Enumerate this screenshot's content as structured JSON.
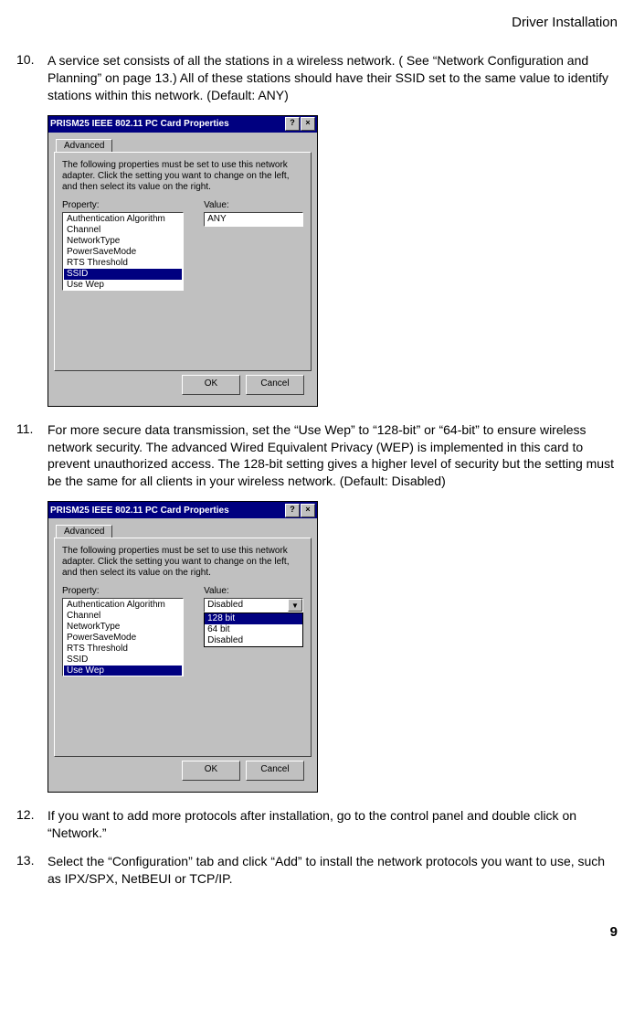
{
  "header": "Driver Installation",
  "page_number": "9",
  "steps": {
    "n10": "10.",
    "t10": "A service set consists of all the stations in a wireless network. ( See “Network Configuration and Planning” on page 13.) All of these stations should have their SSID set to the same value to identify stations within this network. (Default: ANY)",
    "n11": "11.",
    "t11": "For more secure data transmission, set the “Use Wep” to “128-bit” or “64-bit” to ensure wireless network security. The advanced Wired Equivalent Privacy (WEP) is implemented in this card to prevent unauthorized access. The 128-bit setting gives a higher level of security but the setting must be the same for all clients in your wireless network. (Default: Disabled)",
    "n12": "12.",
    "t12": "If you want to add more protocols after installation, go to the control panel and double click on “Network.”",
    "n13": "13.",
    "t13": "Select the “Configuration” tab and click “Add” to install the network protocols you want to use, such as IPX/SPX, NetBEUI or TCP/IP."
  },
  "dialog": {
    "title": "PRISM25 IEEE 802.11 PC Card Properties",
    "help_btn": "?",
    "close_btn": "×",
    "tab": "Advanced",
    "hint": "The following properties must be set to use this network adapter. Click the setting you want to change on the left, and then select its value on the right.",
    "property_label": "Property:",
    "value_label": "Value:",
    "ok": "OK",
    "cancel": "Cancel"
  },
  "shot1": {
    "properties": {
      "p0": "Authentication Algorithm",
      "p1": "Channel",
      "p2": "NetworkType",
      "p3": "PowerSaveMode",
      "p4": "RTS Threshold",
      "p5": "SSID",
      "p6": "Use Wep"
    },
    "selected_property": "SSID",
    "value": "ANY"
  },
  "shot2": {
    "properties": {
      "p0": "Authentication Algorithm",
      "p1": "Channel",
      "p2": "NetworkType",
      "p3": "PowerSaveMode",
      "p4": "RTS Threshold",
      "p5": "SSID",
      "p6": "Use Wep"
    },
    "selected_property": "Use Wep",
    "combo_value": "Disabled",
    "dropdown": {
      "o0": "128 bit",
      "o1": "64 bit",
      "o2": "Disabled"
    },
    "dropdown_selected": "128 bit"
  }
}
